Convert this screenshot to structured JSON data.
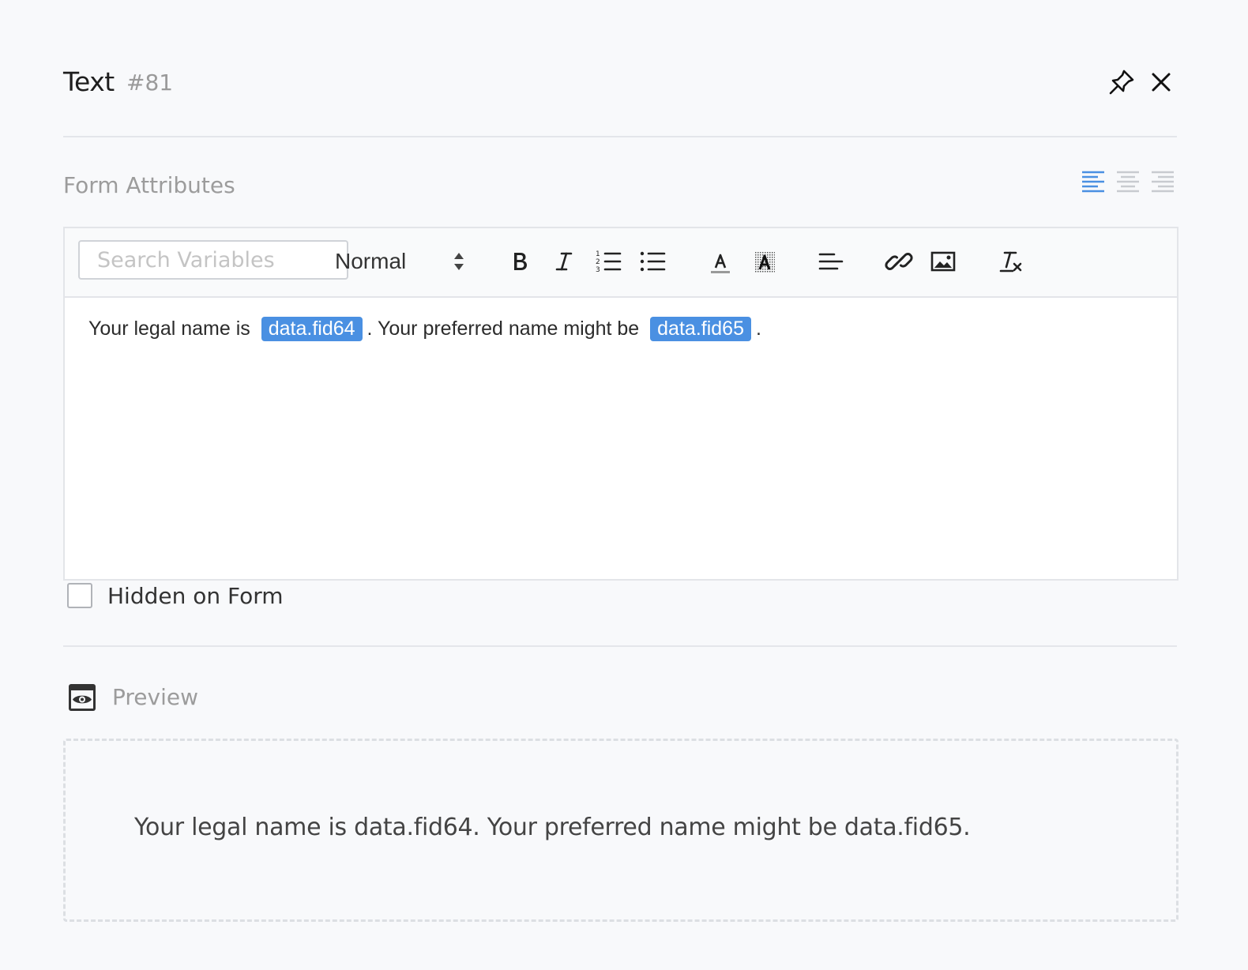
{
  "header": {
    "title": "Text",
    "id_label": "#81"
  },
  "icons": {
    "pin": "pin-icon",
    "close": "close-icon",
    "align_left": "align-left-icon",
    "align_center": "align-center-icon",
    "align_right": "align-right-icon",
    "preview": "eye-icon"
  },
  "section": {
    "label": "Form Attributes",
    "active_alignment": "left"
  },
  "toolbar": {
    "search_placeholder": "Search Variables",
    "format_value": "Normal",
    "buttons": [
      "bold",
      "italic",
      "ordered-list",
      "bullet-list",
      "text-color",
      "background-color",
      "align",
      "link",
      "image",
      "clear-format"
    ]
  },
  "editor": {
    "text_1": "Your legal name is",
    "var_1": "data.fid64",
    "text_2": ". Your preferred name might be",
    "var_2": "data.fid65",
    "text_3": "."
  },
  "options": {
    "hidden_label": "Hidden on Form",
    "hidden_checked": false
  },
  "preview": {
    "label": "Preview",
    "text": "Your legal name is data.fid64. Your preferred name might be data.fid65."
  },
  "colors": {
    "accent": "#4a90e2",
    "background": "#f8f9fb",
    "muted_text": "#9c9c9c"
  }
}
